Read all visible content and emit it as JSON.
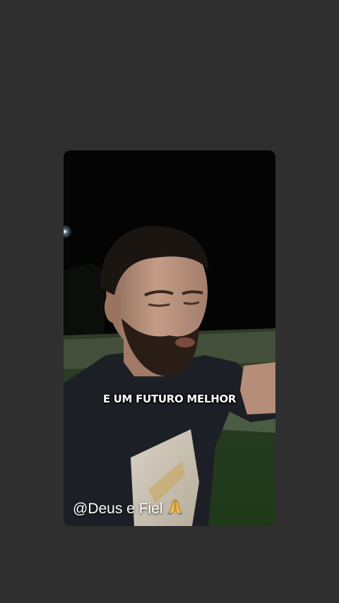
{
  "story": {
    "caption": "E UM FUTURO MELHOR",
    "watermark_handle": "@Deus e Fiel",
    "watermark_icon": "praying-hands-icon"
  },
  "colors": {
    "background": "#302f2f",
    "video_bg": "#040404",
    "text": "#ffffff",
    "icon_yellow": "#f2b84a"
  }
}
